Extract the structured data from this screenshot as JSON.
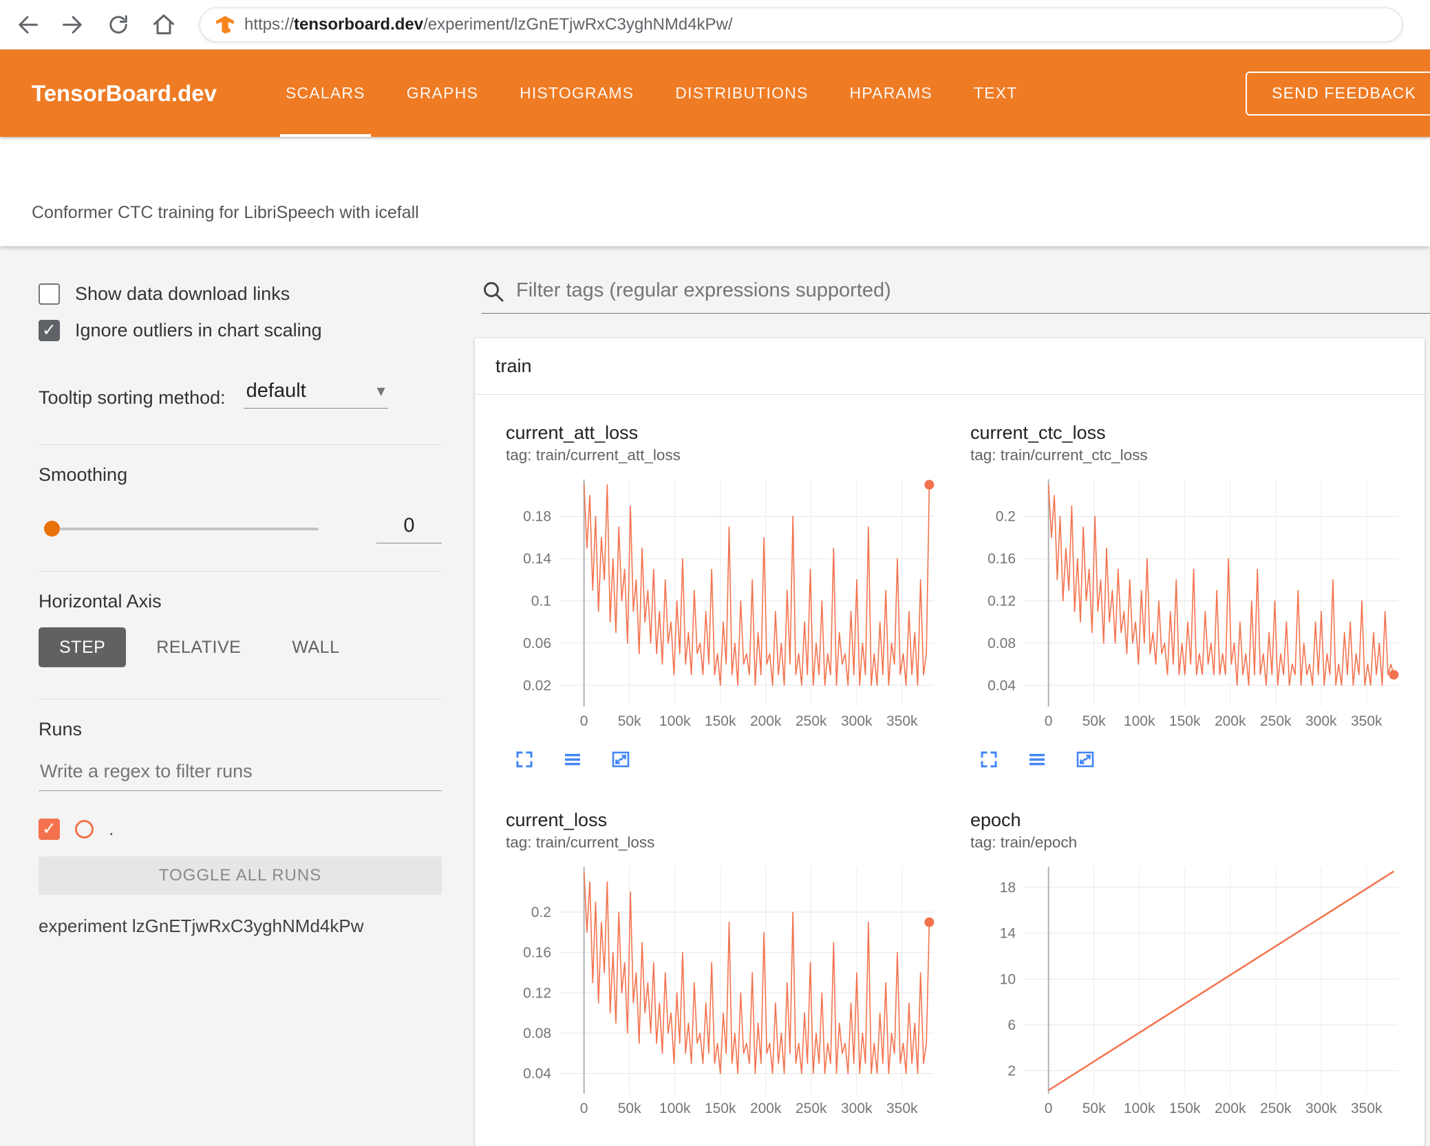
{
  "browser": {
    "url_prefix": "https://",
    "url_domain": "tensorboard.dev",
    "url_path": "/experiment/lzGnETjwRxC3yghNMd4kPw/"
  },
  "header": {
    "brand": "TensorBoard.dev",
    "tabs": [
      {
        "label": "SCALARS",
        "active": true
      },
      {
        "label": "GRAPHS",
        "active": false
      },
      {
        "label": "HISTOGRAMS",
        "active": false
      },
      {
        "label": "DISTRIBUTIONS",
        "active": false
      },
      {
        "label": "HPARAMS",
        "active": false
      },
      {
        "label": "TEXT",
        "active": false
      }
    ],
    "feedback_label": "SEND FEEDBACK"
  },
  "subtitle": "Conformer CTC training for LibriSpeech with icefall",
  "sidebar": {
    "show_links_label": "Show data download links",
    "ignore_outliers_label": "Ignore outliers in chart scaling",
    "tooltip_label": "Tooltip sorting method:",
    "tooltip_value": "default",
    "smoothing_label": "Smoothing",
    "smoothing_value": "0",
    "horizontal_axis_label": "Horizontal Axis",
    "axis_buttons": [
      {
        "label": "STEP",
        "active": true
      },
      {
        "label": "RELATIVE",
        "active": false
      },
      {
        "label": "WALL",
        "active": false
      }
    ],
    "runs_label": "Runs",
    "runs_placeholder": "Write a regex to filter runs",
    "run_item_label": ".",
    "toggle_all_label": "TOGGLE ALL RUNS",
    "experiment_label": "experiment lzGnETjwRxC3yghNMd4kPw"
  },
  "main": {
    "filter_placeholder": "Filter tags (regular expressions supported)",
    "group_title": "train"
  },
  "icons": {
    "dropdown_caret": "▾",
    "checkmark": "✓"
  },
  "colors": {
    "header_orange": "#ef7b24",
    "accent_orange": "#e8710a",
    "run_color": "#f4724d",
    "icon_blue": "#4285f4",
    "checkbox_dark": "#5f6368",
    "step_active_bg": "#616161"
  },
  "chart_data": [
    {
      "type": "line",
      "title": "current_att_loss",
      "tag": "tag: train/current_att_loss",
      "legend": [
        "."
      ],
      "x_tick_values": [
        0,
        50000,
        100000,
        150000,
        200000,
        250000,
        300000,
        350000
      ],
      "x_tick_labels": [
        "0",
        "50k",
        "100k",
        "150k",
        "200k",
        "250k",
        "300k",
        "350k"
      ],
      "xlim": [
        -27000,
        385000
      ],
      "y_tick_values": [
        0.02,
        0.06,
        0.1,
        0.14,
        0.18
      ],
      "y_tick_labels": [
        "0.02",
        "0.06",
        "0.1",
        "0.14",
        "0.18"
      ],
      "ylim": [
        0.0,
        0.215
      ],
      "x_range": [
        0,
        380000
      ],
      "values": [
        0.21,
        0.15,
        0.2,
        0.11,
        0.18,
        0.09,
        0.16,
        0.12,
        0.21,
        0.08,
        0.14,
        0.07,
        0.17,
        0.1,
        0.13,
        0.06,
        0.19,
        0.09,
        0.12,
        0.05,
        0.15,
        0.08,
        0.11,
        0.06,
        0.13,
        0.05,
        0.09,
        0.04,
        0.12,
        0.06,
        0.08,
        0.03,
        0.1,
        0.05,
        0.14,
        0.04,
        0.07,
        0.03,
        0.11,
        0.05,
        0.06,
        0.03,
        0.09,
        0.04,
        0.13,
        0.03,
        0.05,
        0.02,
        0.08,
        0.04,
        0.17,
        0.03,
        0.06,
        0.02,
        0.1,
        0.04,
        0.05,
        0.03,
        0.12,
        0.02,
        0.07,
        0.03,
        0.16,
        0.04,
        0.05,
        0.02,
        0.09,
        0.03,
        0.06,
        0.02,
        0.11,
        0.04,
        0.18,
        0.03,
        0.05,
        0.02,
        0.08,
        0.03,
        0.13,
        0.02,
        0.06,
        0.03,
        0.1,
        0.02,
        0.05,
        0.03,
        0.15,
        0.02,
        0.07,
        0.04,
        0.05,
        0.02,
        0.09,
        0.03,
        0.12,
        0.02,
        0.06,
        0.03,
        0.17,
        0.02,
        0.05,
        0.02,
        0.08,
        0.03,
        0.11,
        0.02,
        0.06,
        0.04,
        0.14,
        0.03,
        0.05,
        0.02,
        0.09,
        0.03,
        0.07,
        0.02,
        0.12,
        0.03,
        0.05,
        0.21
      ],
      "end_marker": true,
      "stroke_width": 1.6,
      "color": "#f4724d"
    },
    {
      "type": "line",
      "title": "current_ctc_loss",
      "tag": "tag: train/current_ctc_loss",
      "legend": [
        "."
      ],
      "x_tick_values": [
        0,
        50000,
        100000,
        150000,
        200000,
        250000,
        300000,
        350000
      ],
      "x_tick_labels": [
        "0",
        "50k",
        "100k",
        "150k",
        "200k",
        "250k",
        "300k",
        "350k"
      ],
      "xlim": [
        -27000,
        385000
      ],
      "y_tick_values": [
        0.04,
        0.08,
        0.12,
        0.16,
        0.2
      ],
      "y_tick_labels": [
        "0.04",
        "0.08",
        "0.12",
        "0.16",
        "0.2"
      ],
      "ylim": [
        0.02,
        0.235
      ],
      "x_range": [
        0,
        380000
      ],
      "values": [
        0.23,
        0.18,
        0.22,
        0.14,
        0.2,
        0.12,
        0.17,
        0.13,
        0.21,
        0.11,
        0.16,
        0.1,
        0.19,
        0.12,
        0.15,
        0.09,
        0.2,
        0.11,
        0.14,
        0.08,
        0.17,
        0.1,
        0.13,
        0.08,
        0.15,
        0.09,
        0.11,
        0.07,
        0.14,
        0.08,
        0.1,
        0.06,
        0.13,
        0.08,
        0.16,
        0.07,
        0.09,
        0.06,
        0.12,
        0.07,
        0.08,
        0.05,
        0.11,
        0.06,
        0.14,
        0.05,
        0.08,
        0.05,
        0.1,
        0.06,
        0.15,
        0.05,
        0.07,
        0.05,
        0.11,
        0.06,
        0.08,
        0.05,
        0.13,
        0.05,
        0.07,
        0.05,
        0.16,
        0.06,
        0.08,
        0.04,
        0.1,
        0.05,
        0.07,
        0.04,
        0.12,
        0.05,
        0.15,
        0.05,
        0.07,
        0.04,
        0.09,
        0.05,
        0.12,
        0.04,
        0.07,
        0.05,
        0.1,
        0.04,
        0.06,
        0.05,
        0.13,
        0.04,
        0.08,
        0.05,
        0.06,
        0.04,
        0.1,
        0.05,
        0.11,
        0.04,
        0.07,
        0.05,
        0.14,
        0.04,
        0.06,
        0.04,
        0.09,
        0.05,
        0.1,
        0.04,
        0.07,
        0.05,
        0.12,
        0.04,
        0.06,
        0.04,
        0.09,
        0.05,
        0.08,
        0.04,
        0.11,
        0.05,
        0.06,
        0.05
      ],
      "end_marker": true,
      "stroke_width": 1.6,
      "color": "#f4724d"
    },
    {
      "type": "line",
      "title": "current_loss",
      "tag": "tag: train/current_loss",
      "legend": [
        "."
      ],
      "x_tick_values": [
        0,
        50000,
        100000,
        150000,
        200000,
        250000,
        300000,
        350000
      ],
      "x_tick_labels": [
        "0",
        "50k",
        "100k",
        "150k",
        "200k",
        "250k",
        "300k",
        "350k"
      ],
      "xlim": [
        -27000,
        385000
      ],
      "y_tick_values": [
        0.04,
        0.08,
        0.12,
        0.16,
        0.2
      ],
      "y_tick_labels": [
        "0.04",
        "0.08",
        "0.12",
        "0.16",
        "0.2"
      ],
      "ylim": [
        0.02,
        0.245
      ],
      "x_range": [
        0,
        380000
      ],
      "values": [
        0.24,
        0.18,
        0.23,
        0.13,
        0.21,
        0.11,
        0.19,
        0.14,
        0.23,
        0.1,
        0.16,
        0.09,
        0.2,
        0.12,
        0.15,
        0.08,
        0.22,
        0.11,
        0.14,
        0.07,
        0.17,
        0.1,
        0.13,
        0.08,
        0.15,
        0.07,
        0.11,
        0.06,
        0.14,
        0.08,
        0.1,
        0.05,
        0.12,
        0.07,
        0.16,
        0.06,
        0.09,
        0.05,
        0.13,
        0.07,
        0.08,
        0.05,
        0.11,
        0.06,
        0.15,
        0.05,
        0.07,
        0.04,
        0.1,
        0.06,
        0.19,
        0.05,
        0.08,
        0.04,
        0.12,
        0.06,
        0.07,
        0.05,
        0.14,
        0.04,
        0.09,
        0.05,
        0.18,
        0.06,
        0.07,
        0.04,
        0.11,
        0.05,
        0.08,
        0.04,
        0.13,
        0.06,
        0.2,
        0.05,
        0.07,
        0.04,
        0.1,
        0.05,
        0.15,
        0.04,
        0.08,
        0.05,
        0.12,
        0.04,
        0.07,
        0.05,
        0.17,
        0.04,
        0.09,
        0.06,
        0.07,
        0.04,
        0.11,
        0.05,
        0.14,
        0.04,
        0.08,
        0.05,
        0.19,
        0.04,
        0.07,
        0.04,
        0.1,
        0.05,
        0.13,
        0.04,
        0.08,
        0.06,
        0.16,
        0.05,
        0.07,
        0.04,
        0.11,
        0.05,
        0.09,
        0.04,
        0.14,
        0.05,
        0.07,
        0.19
      ],
      "end_marker": true,
      "stroke_width": 1.6,
      "color": "#f4724d"
    },
    {
      "type": "line",
      "title": "epoch",
      "tag": "tag: train/epoch",
      "legend": [
        "."
      ],
      "x_tick_values": [
        0,
        50000,
        100000,
        150000,
        200000,
        250000,
        300000,
        350000
      ],
      "x_tick_labels": [
        "0",
        "50k",
        "100k",
        "150k",
        "200k",
        "250k",
        "300k",
        "350k"
      ],
      "xlim": [
        -27000,
        385000
      ],
      "y_tick_values": [
        2,
        6,
        10,
        14,
        18
      ],
      "y_tick_labels": [
        "2",
        "6",
        "10",
        "14",
        "18"
      ],
      "ylim": [
        0,
        19.8
      ],
      "points": [
        [
          0,
          0.3
        ],
        [
          380000,
          19.4
        ]
      ],
      "end_marker": false,
      "stroke_width": 2.5,
      "color": "#f4724d"
    }
  ]
}
